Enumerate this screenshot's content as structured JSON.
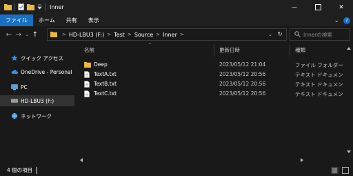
{
  "window": {
    "title": "Inner",
    "minimize_glyph": "—",
    "maximize_glyph": "☐",
    "close_glyph": "✕"
  },
  "ribbon": {
    "tabs": [
      "ファイル",
      "ホーム",
      "共有",
      "表示"
    ],
    "help_glyph": "?",
    "expand_glyph": "⌄"
  },
  "address": {
    "crumbs": [
      "HD-LBU3 (F:)",
      "Test",
      "Source",
      "Inner"
    ],
    "separator": ">",
    "dropdown_glyph": "⌄",
    "refresh_glyph": "↻"
  },
  "search": {
    "placeholder": "Innerの検索"
  },
  "nav": {
    "back_glyph": "←",
    "forward_glyph": "→",
    "recent_glyph": "⌄",
    "up_glyph": "↑",
    "items": [
      {
        "label": "クイック アクセス",
        "icon": "star-icon"
      },
      {
        "label": "OneDrive - Personal",
        "icon": "cloud-icon"
      },
      {
        "label": "PC",
        "icon": "computer-icon"
      },
      {
        "label": "HD-LBU3 (F:)",
        "icon": "drive-icon"
      },
      {
        "label": "ネットワーク",
        "icon": "network-icon"
      }
    ]
  },
  "columns": {
    "name": "名前",
    "modified": "更新日時",
    "type": "種類",
    "sort_glyph": "^"
  },
  "files": [
    {
      "name": "Deep",
      "modified": "2023/05/12 21:04",
      "type": "ファイル フォルダー",
      "icon": "folder-icon"
    },
    {
      "name": "TextA.txt",
      "modified": "2023/05/12 20:56",
      "type": "テキスト ドキュメント",
      "icon": "text-file-icon"
    },
    {
      "name": "TextB.txt",
      "modified": "2023/05/12 20:56",
      "type": "テキスト ドキュメント",
      "icon": "text-file-icon"
    },
    {
      "name": "TextC.txt",
      "modified": "2023/05/12 20:56",
      "type": "テキスト ドキュメント",
      "icon": "text-file-icon"
    }
  ],
  "status": {
    "item_count": "4 個の項目"
  },
  "colors": {
    "accent": "#1a6fc1",
    "folder": "#e8b94a",
    "background": "#191919",
    "selected": "#333333"
  }
}
